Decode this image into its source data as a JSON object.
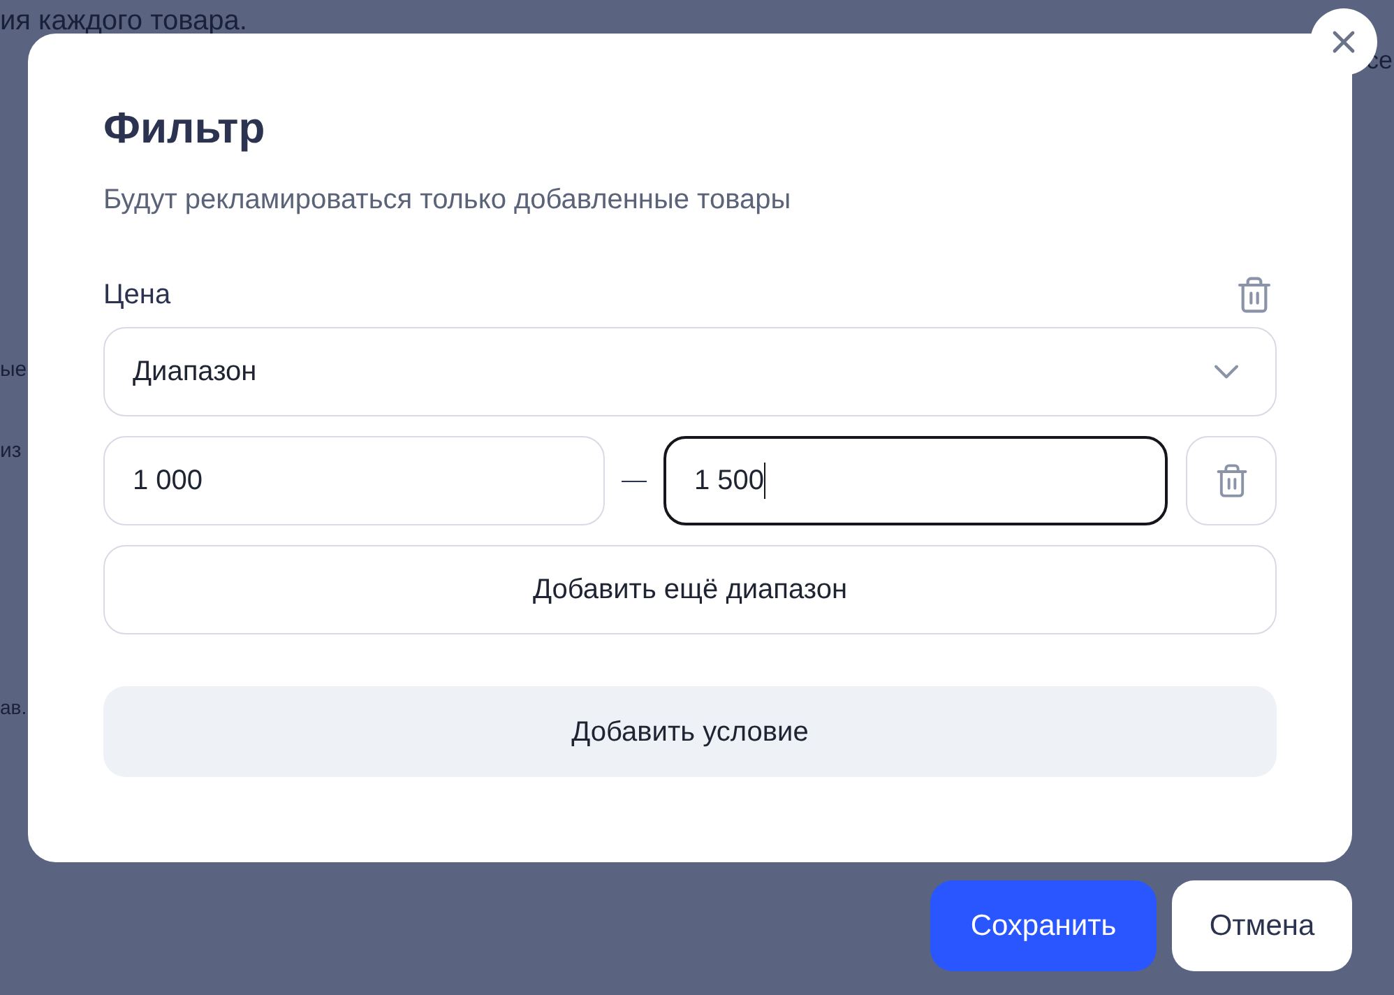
{
  "background": {
    "texts": [
      "ия каждого товара.",
      "се",
      "ые",
      "из",
      "ав."
    ]
  },
  "dialog": {
    "title": "Фильтр",
    "subtitle": "Будут рекламироваться только добавленные товары",
    "condition": {
      "label": "Цена",
      "mode": "Диапазон",
      "ranges": [
        {
          "from": {
            "value": "1 000",
            "focused": false
          },
          "to": {
            "value": "1 500",
            "focused": true
          }
        }
      ]
    },
    "add_range": "Добавить ещё диапазон",
    "add_condition": "Добавить условие"
  },
  "actions": {
    "save": "Сохранить",
    "cancel": "Отмена"
  }
}
